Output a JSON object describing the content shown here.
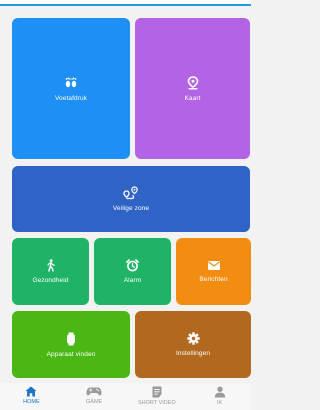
{
  "tiles": {
    "voetafdruk": {
      "label": "Voetafdruk",
      "color": "#1e8ff5",
      "icon": "footprints-icon"
    },
    "kaart": {
      "label": "Kaart",
      "color": "#b363e6",
      "icon": "map-pin-icon"
    },
    "veilige_zone": {
      "label": "Veilige zone",
      "color": "#2f64c6",
      "icon": "location-route-icon"
    },
    "gezondheid": {
      "label": "Gezondheid",
      "color": "#1fb465",
      "icon": "walking-person-icon"
    },
    "alarm": {
      "label": "Alarm",
      "color": "#1fb465",
      "icon": "alarm-clock-icon"
    },
    "berichten": {
      "label": "Berichten",
      "color": "#f28d12",
      "icon": "envelope-icon"
    },
    "apparaat_vinden": {
      "label": "Apparaat vinden",
      "color": "#4ab714",
      "icon": "watch-icon"
    },
    "instellingen": {
      "label": "Instellingen",
      "color": "#b1681f",
      "icon": "gear-icon"
    }
  },
  "tabbar": {
    "active_color": "#1e74c6",
    "inactive_color": "#9a9a9a",
    "items": [
      {
        "label": "HOME",
        "icon": "home-icon",
        "active": true
      },
      {
        "label": "GAME",
        "icon": "gamepad-icon",
        "active": false
      },
      {
        "label": "SHORT VIDEO",
        "icon": "document-icon",
        "active": false
      },
      {
        "label": "IK",
        "icon": "person-icon",
        "active": false
      }
    ]
  }
}
